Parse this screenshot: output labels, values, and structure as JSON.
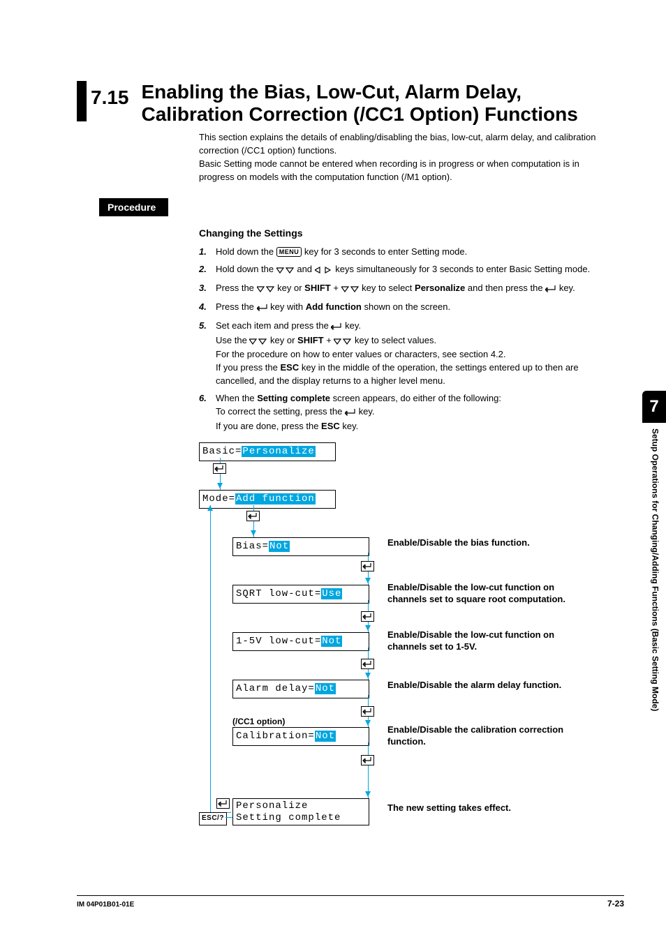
{
  "section_number": "7.15",
  "section_title": "Enabling the Bias, Low-Cut, Alarm Delay, Calibration Correction (/CC1 Option) Functions",
  "intro_p1": "This section explains the details of enabling/disabling the bias, low-cut, alarm delay, and calibration correction (/CC1 option) functions.",
  "intro_p2": "Basic Setting mode cannot be entered when recording is in progress or when computation is in progress on models with the computation function (/M1 option).",
  "procedure_label": "Procedure",
  "changing_heading": "Changing the Settings",
  "steps": {
    "s1a": "Hold down the ",
    "s1b": " key for 3 seconds to enter Setting mode.",
    "s2a": "Hold down the ",
    "s2b": " and ",
    "s2c": " keys simultaneously for 3 seconds to enter Basic Setting mode.",
    "s3a": "Press the ",
    "s3b": " key or ",
    "s3shift": "SHIFT",
    "s3c": " + ",
    "s3d": " key to select ",
    "s3pers": "Personalize",
    "s3e": " and then press the ",
    "s3f": " key.",
    "s4a": "Press the ",
    "s4b": " key with ",
    "s4add": "Add function",
    "s4c": " shown on the screen.",
    "s5a": "Set each item and press the ",
    "s5b": " key.",
    "s5c": "Use the ",
    "s5d": " key or ",
    "s5shift": "SHIFT",
    "s5e": " + ",
    "s5f": " key to select values.",
    "s5g": "For the procedure on how to enter values or characters, see section 4.2.",
    "s5h": "If you press the ",
    "s5esc": "ESC",
    "s5i": " key in the middle of the operation, the settings entered up to then are cancelled, and the display returns to a higher level menu.",
    "s6a": "When the ",
    "s6sc": "Setting complete",
    "s6b": " screen appears, do either of the following:",
    "s6c": "To correct the setting, press the ",
    "s6d": " key.",
    "s6e": "If you are done, press the ",
    "s6esc": "ESC",
    "s6f": " key."
  },
  "menu_key": "MENU",
  "diagram": {
    "row0_l": "Basic=",
    "row0_v": "Personalize",
    "row1_l": "Mode=",
    "row1_v": "Add function",
    "row2_l": "Bias=",
    "row2_v": "Not",
    "row3_l": "SQRT low-cut=",
    "row3_v": "Use",
    "row4_l": "1-5V low-cut=",
    "row4_v": "Not",
    "row5_l": "Alarm delay=",
    "row5_v": "Not",
    "row6_l": "Calibration=",
    "row6_v": "Not",
    "row7a": "Personalize",
    "row7b": "Setting complete",
    "cap2": "Enable/Disable the bias function.",
    "cap3": "Enable/Disable the low-cut function on channels set to square root computation.",
    "cap4": "Enable/Disable the low-cut function on channels set to 1-5V.",
    "cap5": "Enable/Disable the alarm delay function.",
    "cap6": "Enable/Disable the calibration correction function.",
    "cap7": "The new setting takes effect.",
    "option": "(/CC1 option)",
    "esc": "ESC/?"
  },
  "side": {
    "num": "7",
    "text": "Setup Operations for Changing/Adding Functions (Basic Setting Mode)"
  },
  "footer": {
    "left": "IM 04P01B01-01E",
    "right": "7-23"
  }
}
